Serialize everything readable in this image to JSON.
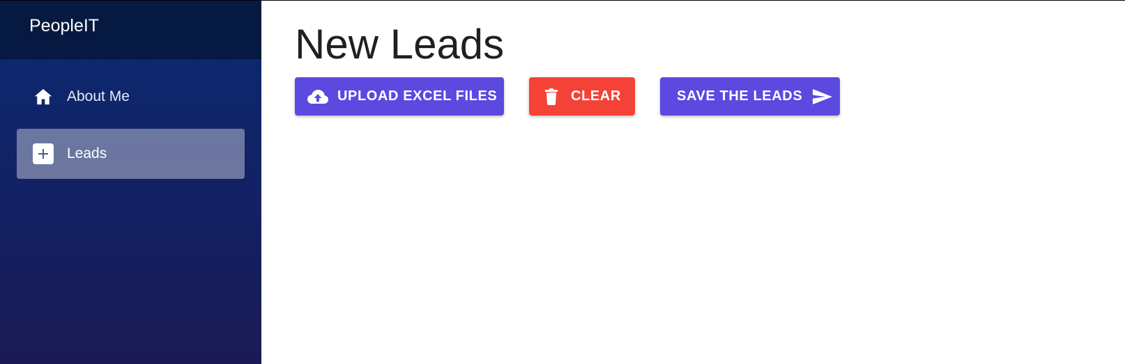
{
  "app": {
    "brand": "PeopleIT"
  },
  "sidebar": {
    "items": [
      {
        "label": "About Me",
        "icon": "home-icon",
        "active": false
      },
      {
        "label": "Leads",
        "icon": "plus-box-icon",
        "active": true
      }
    ]
  },
  "main": {
    "title": "New Leads",
    "buttons": {
      "upload_label": "UPLOAD EXCEL FILES",
      "upload_icon": "cloud-upload-icon",
      "clear_label": "CLEAR",
      "clear_icon": "trash-icon",
      "save_label": "SAVE THE LEADS",
      "save_icon": "send-icon"
    }
  },
  "colors": {
    "primary": "#5c49e0",
    "danger": "#f44336",
    "sidebar_top": "#0a2a72",
    "sidebar_bottom": "#1b1a56",
    "brand_bar": "#061940"
  }
}
